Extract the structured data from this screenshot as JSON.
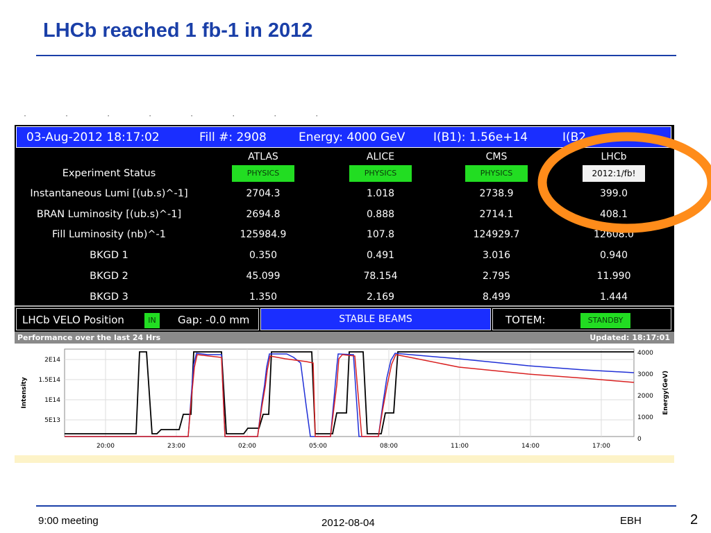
{
  "slide": {
    "title": "LHCb reached 1 fb-1 in 2012",
    "footer_left": "9:00 meeting",
    "footer_center": "2012-08-04",
    "footer_author": "EBH",
    "page_number": "2"
  },
  "header": {
    "datetime": "03-Aug-2012 18:17:02",
    "fill": "Fill #: 2908",
    "energy": "Energy: 4000 GeV",
    "ib1": "I(B1): 1.56e+14",
    "ib2_partial": "I(B2"
  },
  "experiments": [
    "ATLAS",
    "ALICE",
    "CMS",
    "LHCb"
  ],
  "rows": [
    {
      "label": "Experiment Status",
      "values": [
        "PHYSICS",
        "PHYSICS",
        "PHYSICS",
        "2012:1/fb!"
      ]
    },
    {
      "label": "Instantaneous Lumi [(ub.s)^-1]",
      "values": [
        "2704.3",
        "1.018",
        "2738.9",
        "399.0"
      ]
    },
    {
      "label": "BRAN Luminosity [(ub.s)^-1]",
      "values": [
        "2694.8",
        "0.888",
        "2714.1",
        "408.1"
      ]
    },
    {
      "label": "Fill Luminosity (nb)^-1",
      "values": [
        "125984.9",
        "107.8",
        "124929.7",
        "12608.0"
      ]
    },
    {
      "label": "BKGD 1",
      "values": [
        "0.350",
        "0.491",
        "3.016",
        "0.940"
      ]
    },
    {
      "label": "BKGD 2",
      "values": [
        "45.099",
        "78.154",
        "2.795",
        "11.990"
      ]
    },
    {
      "label": "BKGD 3",
      "values": [
        "1.350",
        "2.169",
        "8.499",
        "1.444"
      ]
    }
  ],
  "status": {
    "velo_label": "LHCb VELO Position",
    "velo_badge": "IN",
    "gap": "Gap: -0.0 mm",
    "beam_mode": "STABLE BEAMS",
    "totem_label": "TOTEM:",
    "totem_badge": "STANDBY"
  },
  "performance": {
    "title": "Performance over the last 24 Hrs",
    "updated": "Updated: 18:17:01",
    "y_label": "Intensity",
    "y2_label": "Energy(GeV)",
    "y_ticks": [
      "2E14",
      "1.5E14",
      "1E14",
      "5E13"
    ],
    "y2_ticks": [
      "4000",
      "3000",
      "2000",
      "1000",
      "0"
    ],
    "x_ticks": [
      "20:00",
      "23:00",
      "02:00",
      "05:00",
      "08:00",
      "11:00",
      "14:00",
      "17:00"
    ]
  },
  "colors": {
    "title_blue": "#1a3fa8",
    "header_blue": "#1a2eff",
    "badge_green": "#22dd22",
    "highlight_orange": "#ff8c1a",
    "beam1": "#1f2fd6",
    "beam2": "#d92020",
    "energy": "#000000"
  }
}
